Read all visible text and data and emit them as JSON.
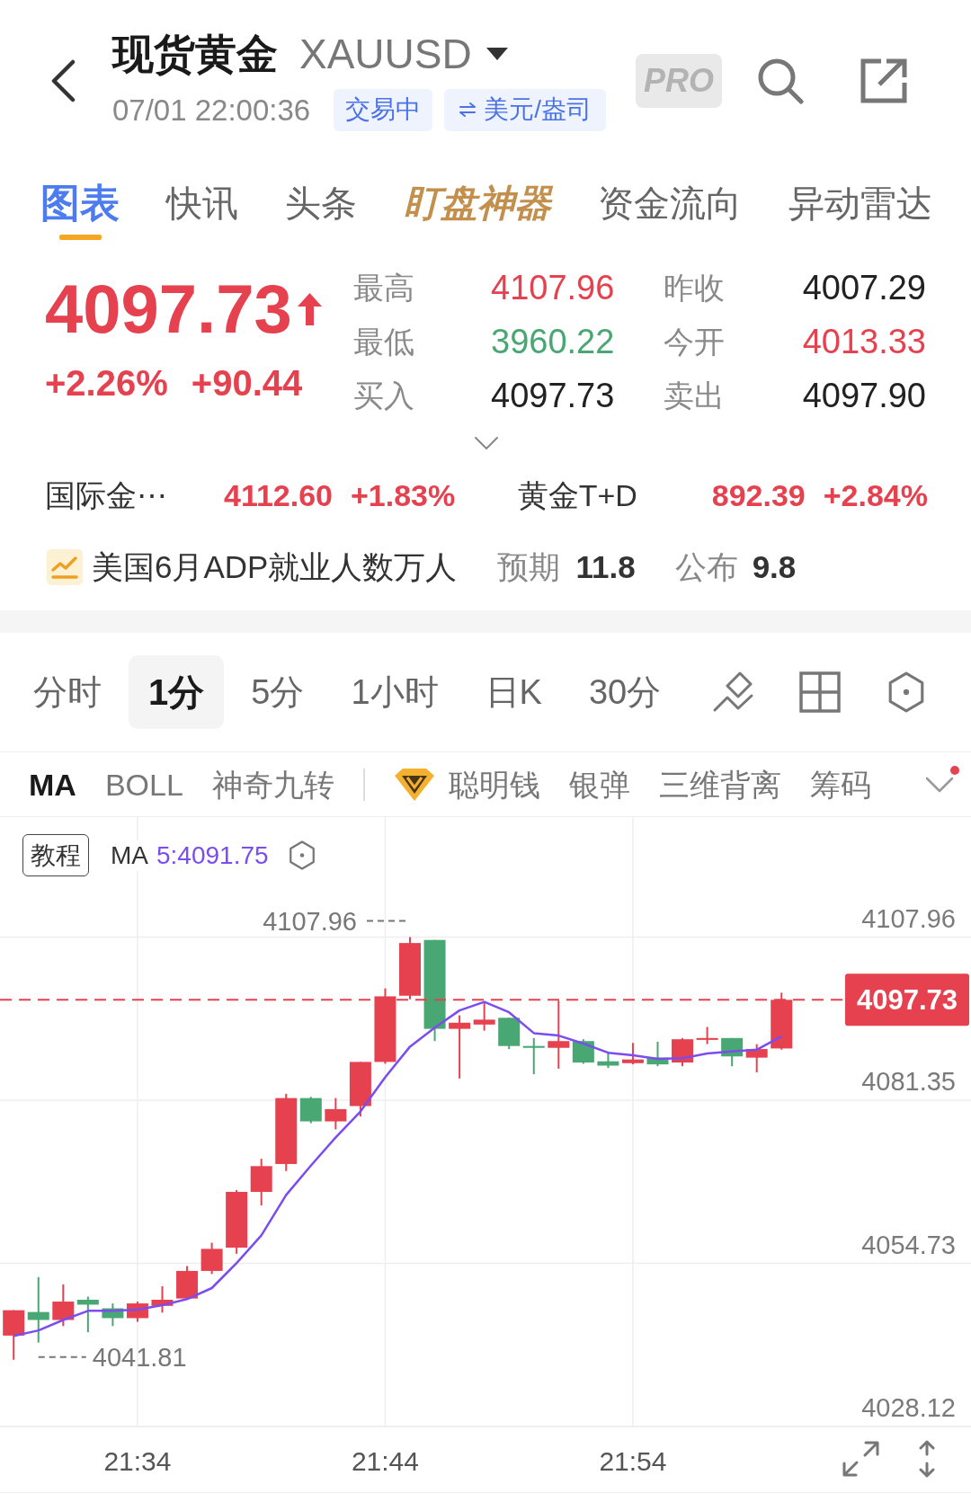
{
  "header": {
    "title": "现货黄金",
    "symbol": "XAUUSD",
    "timestamp": "07/01 22:00:36",
    "status_badge": "交易中",
    "unit_badge": "美元/盎司",
    "pro_badge": "PRO"
  },
  "tabs": [
    {
      "label": "图表",
      "selected": true,
      "kind": "plain"
    },
    {
      "label": "快讯",
      "selected": false,
      "kind": "plain"
    },
    {
      "label": "头条",
      "selected": false,
      "kind": "plain"
    },
    {
      "label": "盯盘神器",
      "selected": false,
      "kind": "featured"
    },
    {
      "label": "资金流向",
      "selected": false,
      "kind": "plain"
    },
    {
      "label": "异动雷达",
      "selected": false,
      "kind": "plain"
    }
  ],
  "quote": {
    "price": "4097.73",
    "rising": true,
    "change_percent": "+2.26%",
    "change": "+90.44",
    "stats": [
      {
        "label": "最高",
        "value": "4107.96",
        "color": "#e5414f"
      },
      {
        "label": "昨收",
        "value": "4007.29",
        "color": "#222222"
      },
      {
        "label": "最低",
        "value": "3960.22",
        "color": "#48a772"
      },
      {
        "label": "今开",
        "value": "4013.33",
        "color": "#e5414f"
      },
      {
        "label": "买入",
        "value": "4097.73",
        "color": "#222222"
      },
      {
        "label": "卖出",
        "value": "4097.90",
        "color": "#222222"
      }
    ]
  },
  "related": [
    {
      "name": "国际金⋯",
      "price": "4112.60",
      "change": "+1.83%",
      "rising": true
    },
    {
      "name": "黄金T+D",
      "price": "892.39",
      "change": "+2.84%",
      "rising": true
    }
  ],
  "event": {
    "title": "美国6月ADP就业人数万人",
    "forecast_label": "预期",
    "forecast": "11.8",
    "actual_label": "公布",
    "actual": "9.8"
  },
  "periods": [
    {
      "label": "分时",
      "selected": false
    },
    {
      "label": "1分",
      "selected": true
    },
    {
      "label": "5分",
      "selected": false
    },
    {
      "label": "1小时",
      "selected": false
    },
    {
      "label": "日K",
      "selected": false
    },
    {
      "label": "30分",
      "selected": false
    }
  ],
  "indicator_groups": [
    {
      "kind": "basic",
      "items": [
        {
          "label": "MA",
          "selected": true
        },
        {
          "label": "BOLL",
          "selected": false
        },
        {
          "label": "神奇九转",
          "selected": false
        }
      ]
    },
    {
      "kind": "premium",
      "items": [
        {
          "label": "聪明钱",
          "selected": false
        },
        {
          "label": "银弹",
          "selected": false
        },
        {
          "label": "三维背离",
          "selected": false
        },
        {
          "label": "筹码",
          "selected": false
        }
      ]
    }
  ],
  "indicator_menu": {
    "has_update": true
  },
  "chart": {
    "tutorial_button": "教程",
    "ma_label": "MA",
    "ma_value": "5:4091.75",
    "high_marker": "4107.96",
    "low_marker": "4041.81",
    "chart_data": {
      "type": "line",
      "categories": [
        null,
        null,
        null,
        null,
        null,
        "21:34",
        null,
        null,
        null,
        null,
        null,
        null,
        null,
        null,
        null,
        "21:44",
        null,
        null,
        null,
        null,
        null,
        null,
        null,
        null,
        null,
        "21:54",
        null,
        null,
        null,
        null,
        null,
        null
      ],
      "series": [
        {
          "color": "#7b4cf0",
          "values": [
            4042.9,
            4043.8,
            4045.5,
            4047.0,
            4047.0,
            4047.2,
            4047.9,
            4048.9,
            4050.7,
            4054.8,
            4059.3,
            4065.9,
            4070.7,
            4075.3,
            4079.5,
            4085.1,
            4090.1,
            4093.2,
            4096.0,
            4097.4,
            4095.7,
            4092.3,
            4091.9,
            4090.6,
            4089.1,
            4088.7,
            4088.1,
            4088.2,
            4089.0,
            4089.3,
            4089.6,
            4091.8
          ]
        }
      ],
      "ylim": [
        4028.12,
        4127.55
      ],
      "yticks": [
        4107.96,
        4081.35,
        4054.73,
        4028.12
      ],
      "grid": true,
      "ref_lines": [
        {
          "axis": "y",
          "value": 4097.73,
          "label": "4097.73",
          "color": "#e5414f"
        }
      ]
    }
  }
}
